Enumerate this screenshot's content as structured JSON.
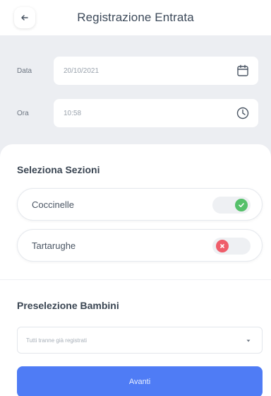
{
  "header": {
    "title": "Registrazione Entrata",
    "back_icon": "arrow-left-icon"
  },
  "form": {
    "date": {
      "label": "Data",
      "value": "20/10/2021",
      "icon": "calendar-icon"
    },
    "time": {
      "label": "Ora",
      "value": "10:58",
      "icon": "clock-icon"
    }
  },
  "sections": {
    "title": "Seleziona Sezioni",
    "items": [
      {
        "label": "Coccinelle",
        "state": "selected",
        "icon": "check-icon",
        "color": "#55c06a"
      },
      {
        "label": "Tartarughe",
        "state": "unselected",
        "icon": "x-icon",
        "color": "#ef5d6a"
      }
    ]
  },
  "children": {
    "title": "Preselezione Bambini",
    "select_value": "Tutti tranne già registrati"
  },
  "actions": {
    "next_label": "Avanti"
  },
  "colors": {
    "primary": "#4f7cf5",
    "background": "#eceef2"
  }
}
